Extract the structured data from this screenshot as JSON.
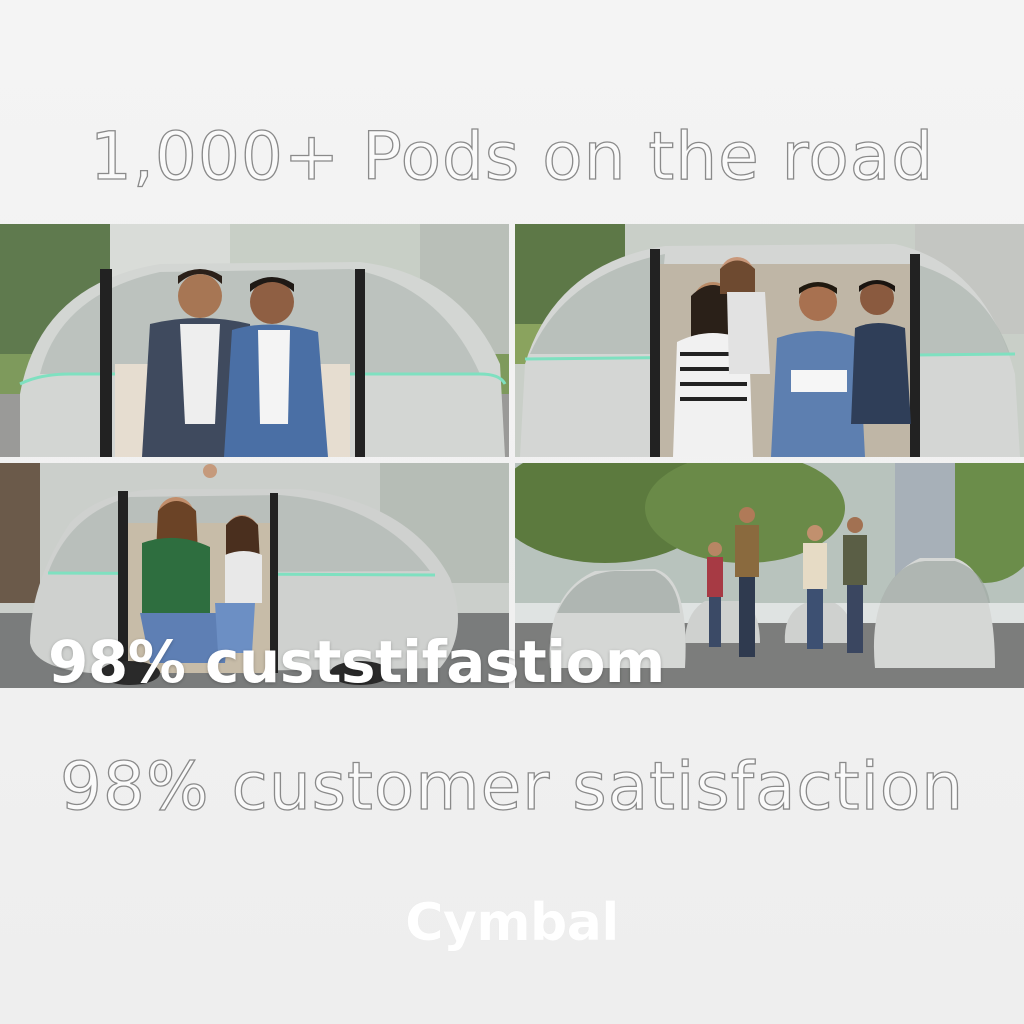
{
  "headline_top": "1,000+ Pods on the road",
  "headline_bottom": "98% customer satisfaction",
  "overlay_text": "98% custstifastiom",
  "brand": "Cymbal",
  "colors": {
    "pod_body": "#c9cbc9",
    "pod_accent_line": "#7fe0c0",
    "background": "#f2f2f2"
  },
  "photos": [
    {
      "subject": "two men sitting in an open autonomous pod"
    },
    {
      "subject": "four passengers laughing inside a pod"
    },
    {
      "subject": "mother and daughter high-fiving in a pod"
    },
    {
      "subject": "group of people walking past parked pods on a city street"
    }
  ]
}
